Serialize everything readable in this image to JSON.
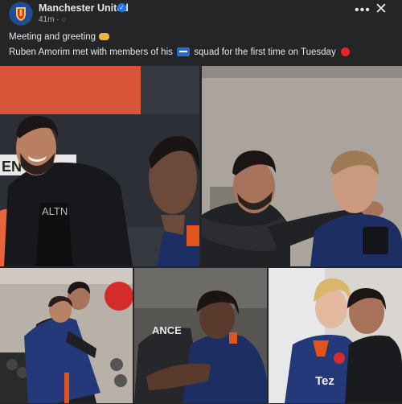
{
  "post": {
    "page_name": "Manchester United",
    "time": "41m",
    "meta_separator": "·",
    "line1": "Meeting and greeting",
    "line2_a": "Ruben Amorim met with members of his",
    "line2_b": "squad for the first time on Tuesday"
  },
  "icons": {
    "verified": "✓",
    "globe": "◌",
    "more": "•••",
    "close": "✕",
    "emojis": [
      "handshake-emoji",
      "soon-arrow-emoji",
      "red-circle-emoji"
    ]
  },
  "photos": {
    "p1": {
      "sign_text": "EN",
      "shirt_text": "ALTN"
    },
    "p4": {
      "jacket_text": "ANCE"
    },
    "p5": {
      "sponsor_text": "Tez"
    }
  },
  "colors": {
    "background": "#242526",
    "text": "#e4e6eb",
    "verified": "#1877f2",
    "united_navy": "#1b2a4e",
    "accent_red": "#e8212b"
  }
}
